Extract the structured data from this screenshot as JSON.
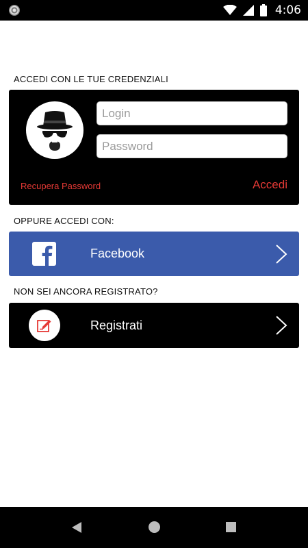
{
  "status_bar": {
    "time": "4:06",
    "icons": [
      "app-notification-icon",
      "wifi-icon",
      "cellular-signal-icon",
      "battery-icon"
    ]
  },
  "login_section": {
    "label": "ACCEDI CON LE TUE CREDENZIALI",
    "login_placeholder": "Login",
    "login_value": "",
    "password_placeholder": "Password",
    "password_value": "",
    "recover_password": "Recupera Password",
    "submit_label": "Accedi",
    "avatar_icon": "hat-and-sunglasses-avatar-icon"
  },
  "social_section": {
    "label": "OPPURE ACCEDI CON:",
    "facebook_label": "Facebook",
    "facebook_icon": "facebook-icon",
    "facebook_color": "#3b5bab"
  },
  "register_section": {
    "label": "NON SEI ANCORA REGISTRATO?",
    "register_label": "Registrati",
    "register_icon": "edit-note-icon"
  },
  "colors": {
    "accent_red": "#e53935",
    "card_background": "#000000",
    "facebook_blue": "#3b5bab"
  },
  "nav_bar": {
    "icons": [
      "back-icon",
      "home-icon",
      "recents-icon"
    ]
  }
}
